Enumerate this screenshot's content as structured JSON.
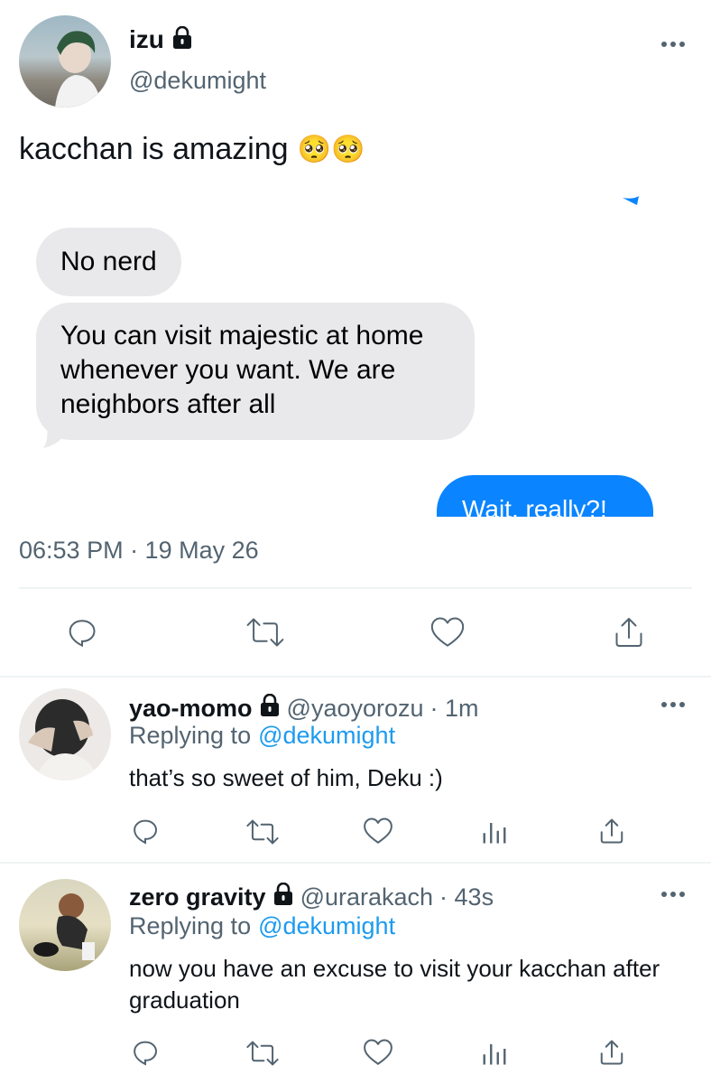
{
  "main_tweet": {
    "display_name": "izu",
    "handle": "@dekumight",
    "text": "kacchan is amazing",
    "emoji": "🥺🥺",
    "timestamp": "06:53 PM · 19 May 26",
    "screenshot": {
      "messages": [
        {
          "from": "them",
          "text": "No nerd"
        },
        {
          "from": "them",
          "text": "You can visit majestic at home whenever you want. We are neighbors after all"
        },
        {
          "from": "me",
          "text": "Wait, really?!"
        }
      ]
    },
    "actions": [
      "reply-icon",
      "retweet-icon",
      "like-icon",
      "share-icon"
    ]
  },
  "replies": [
    {
      "display_name": "yao-momo",
      "handle": "@yaoyorozu",
      "time": "· 1m",
      "replying_prefix": "Replying to",
      "replying_to": "@dekumight",
      "text": "that’s so sweet of him, Deku :)",
      "actions": [
        "reply-icon",
        "retweet-icon",
        "like-icon",
        "analytics-icon",
        "share-icon"
      ]
    },
    {
      "display_name": "zero gravity",
      "handle": "@urarakach",
      "time": "· 43s",
      "replying_prefix": "Replying to",
      "replying_to": "@dekumight",
      "text": "now you have an excuse to visit your kacchan after graduation",
      "actions": [
        "reply-icon",
        "retweet-icon",
        "like-icon",
        "analytics-icon",
        "share-icon"
      ]
    }
  ],
  "colors": {
    "link_blue": "#1d9bf0",
    "imessage_blue": "#0a84ff",
    "bubble_gray": "#e9e9eb",
    "secondary_text": "#536471"
  }
}
